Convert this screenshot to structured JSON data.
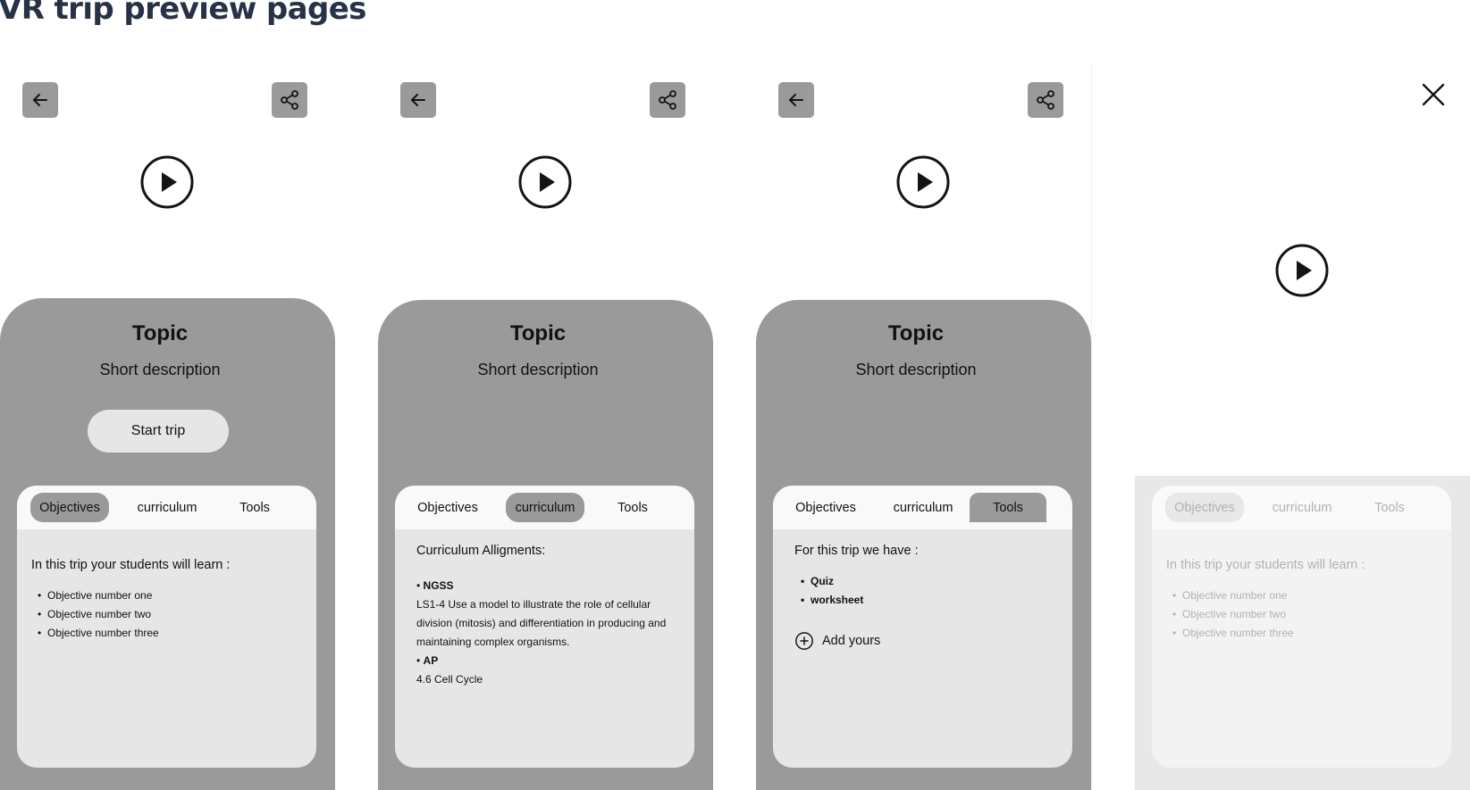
{
  "page": {
    "title": "VR trip preview pages"
  },
  "screens": [
    {
      "topic": "Topic",
      "description": "Short description",
      "start_button": "Start trip",
      "tabs": [
        "Objectives",
        "curriculum",
        "Tools"
      ],
      "active_tab": "Objectives",
      "objectives": {
        "lead": "In this trip your students will learn :",
        "items": [
          "Objective number one",
          "Objective number two",
          "Objective number three"
        ]
      }
    },
    {
      "topic": "Topic",
      "description": "Short description",
      "tabs": [
        "Objectives",
        "curriculum",
        "Tools"
      ],
      "active_tab": "curriculum",
      "curriculum": {
        "lead": "Curriculum Alligments:",
        "standards": [
          {
            "name": "NGSS",
            "text": "LS1-4 Use a model to illustrate the role of cellular division (mitosis) and differentiation in producing and maintaining complex organisms."
          },
          {
            "name": "AP",
            "text": "4.6 Cell Cycle"
          }
        ]
      }
    },
    {
      "topic": "Topic",
      "description": "Short description",
      "tabs": [
        "Objectives",
        "curriculum",
        "Tools"
      ],
      "active_tab": "Tools",
      "tools": {
        "lead": "For this trip we have :",
        "items": [
          "Quiz",
          "worksheet"
        ],
        "add_label": "Add yours"
      }
    },
    {
      "tabs": [
        "Objectives",
        "curriculum",
        "Tools"
      ],
      "active_tab": "Objectives",
      "objectives": {
        "lead": "In this trip your students will learn :",
        "items": [
          "Objective number one",
          "Objective number two",
          "Objective number three"
        ]
      }
    }
  ],
  "icons": {
    "back": "arrow-left-icon",
    "share": "share-icon",
    "play": "play-icon",
    "close": "close-icon",
    "add": "plus-circle-icon"
  },
  "colors": {
    "title": "#273246",
    "sheet": "#9a9a9a",
    "card": "#e6e6e6",
    "tabbar": "#f9f9f9",
    "start_button": "#e6e6e6"
  }
}
